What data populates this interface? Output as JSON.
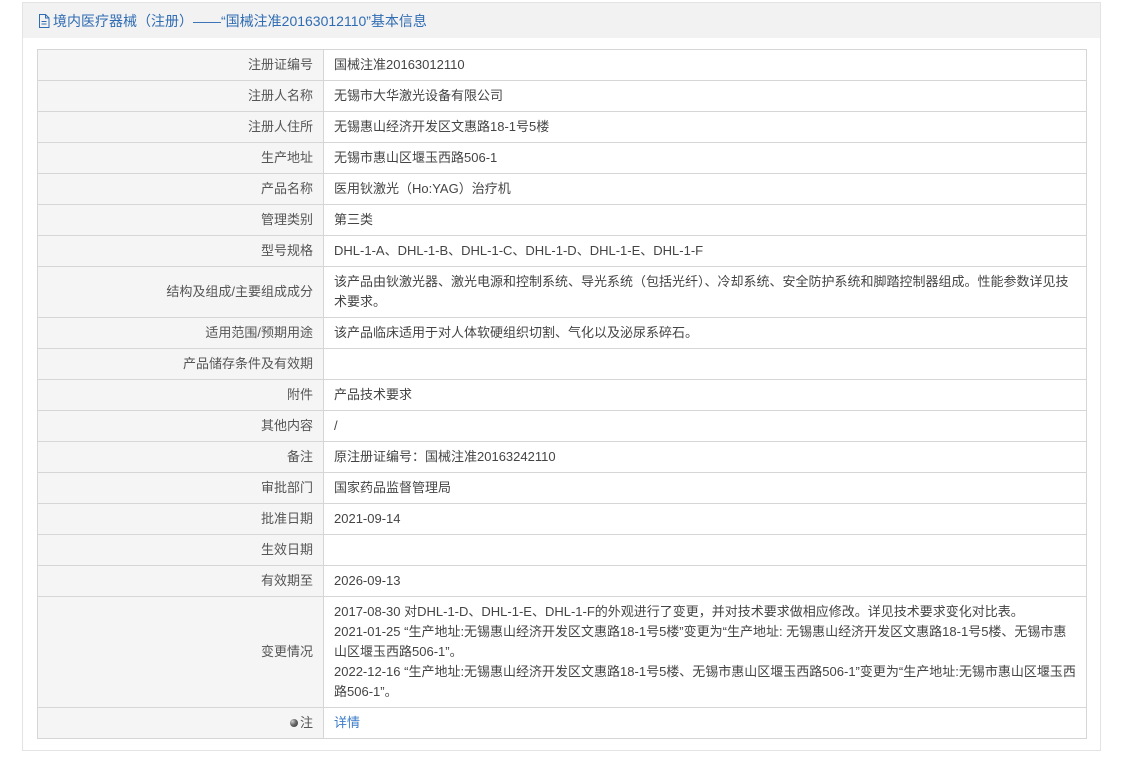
{
  "header": {
    "icon": "document-icon",
    "title": "境内医疗器械（注册）——“国械注准20163012110”基本信息"
  },
  "rows": [
    {
      "label": "注册证编号",
      "value": "国械注准20163012110"
    },
    {
      "label": "注册人名称",
      "value": "无锡市大华激光设备有限公司"
    },
    {
      "label": "注册人住所",
      "value": "无锡惠山经济开发区文惠路18-1号5楼"
    },
    {
      "label": "生产地址",
      "value": "无锡市惠山区堰玉西路506-1"
    },
    {
      "label": "产品名称",
      "value": "医用钬激光（Ho:YAG）治疗机"
    },
    {
      "label": "管理类别",
      "value": "第三类"
    },
    {
      "label": "型号规格",
      "value": "DHL-1-A、DHL-1-B、DHL-1-C、DHL-1-D、DHL-1-E、DHL-1-F"
    },
    {
      "label": "结构及组成/主要组成成分",
      "value": "该产品由钬激光器、激光电源和控制系统、导光系统（包括光纤）、冷却系统、安全防护系统和脚踏控制器组成。性能参数详见技术要求。"
    },
    {
      "label": "适用范围/预期用途",
      "value": "该产品临床适用于对人体软硬组织切割、气化以及泌尿系碎石。"
    },
    {
      "label": "产品储存条件及有效期"
    },
    {
      "label": "附件",
      "value": "产品技术要求"
    },
    {
      "label": "其他内容",
      "value": "/"
    },
    {
      "label": "备注",
      "value": "原注册证编号：国械注准20163242110"
    },
    {
      "label": "审批部门",
      "value": "国家药品监督管理局"
    },
    {
      "label": "批准日期",
      "value": "2021-09-14"
    },
    {
      "label": "生效日期"
    },
    {
      "label": "有效期至",
      "value": "2026-09-13"
    },
    {
      "label": "变更情况",
      "lines": [
        "2017-08-30 对DHL-1-D、DHL-1-E、DHL-1-F的外观进行了变更，并对技术要求做相应修改。详见技术要求变化对比表。",
        "2021-01-25 “生产地址:无锡惠山经济开发区文惠路18-1号5楼”变更为“生产地址: 无锡惠山经济开发区文惠路18-1号5楼、无锡市惠山区堰玉西路506-1”。",
        "2022-12-16 “生产地址:无锡惠山经济开发区文惠路18-1号5楼、无锡市惠山区堰玉西路506-1”变更为“生产地址:无锡市惠山区堰玉西路506-1”。"
      ]
    },
    {
      "label": "注",
      "icon": "bullet-icon",
      "link": "详情"
    }
  ],
  "colors": {
    "title": "#2f6cb3",
    "link": "#3a7bc8",
    "label_bg": "#f5f5f5",
    "label_text": "#555555",
    "border": "#d6d6d6",
    "header_bg": "#f2f2f2",
    "panel_border": "#e3e3e3",
    "text": "#444444"
  }
}
